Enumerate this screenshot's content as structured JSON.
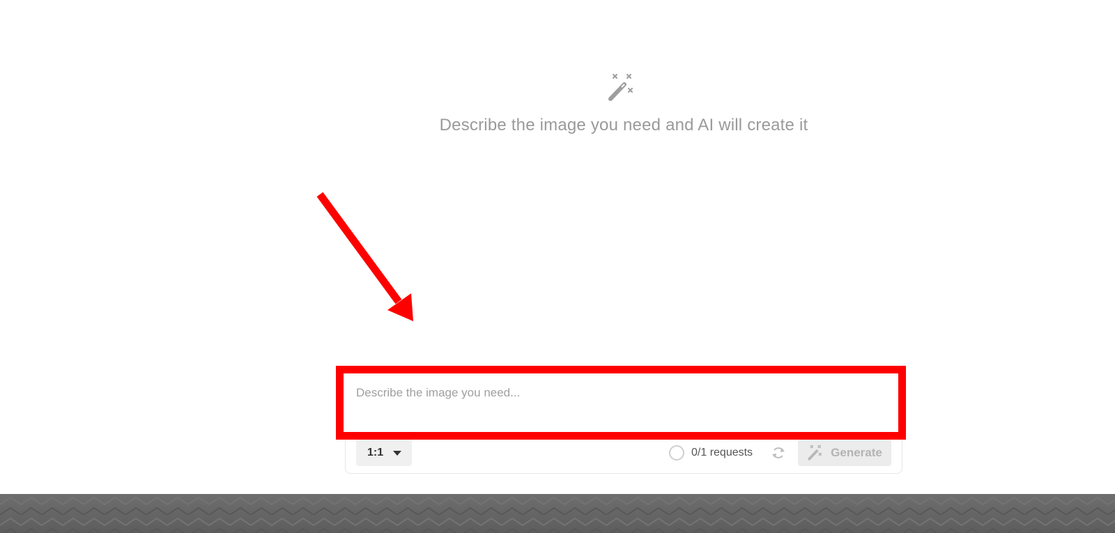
{
  "hero": {
    "icon": "magic-wand-icon",
    "text": "Describe the image you need and AI will create it"
  },
  "composer": {
    "placeholder": "Describe the image you need...",
    "value": "",
    "ratio": "1:1",
    "requests_text": "0/1 requests",
    "generate_label": "Generate"
  },
  "annotation": {
    "color": "#ff0000",
    "type": "arrow-and-highlight-box"
  },
  "footer": {
    "color": "#666666"
  }
}
